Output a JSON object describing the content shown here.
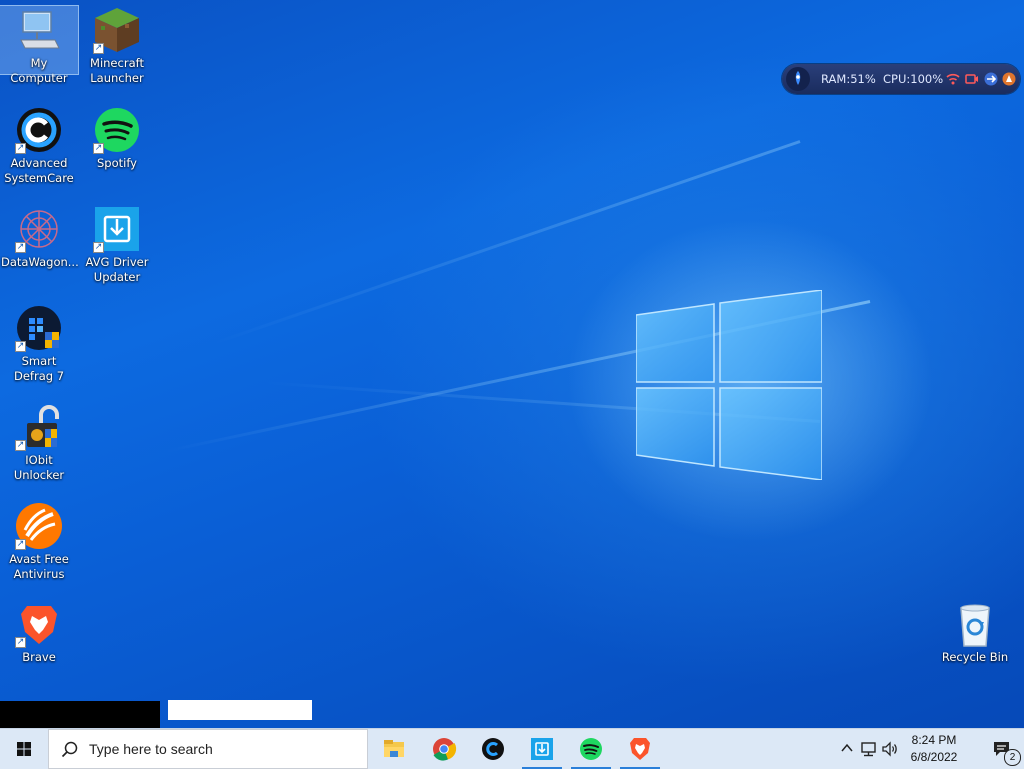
{
  "desktop": {
    "icons": [
      {
        "label": "My Computer",
        "icon": "computer-icon"
      },
      {
        "label": "Minecraft Launcher",
        "icon": "minecraft-icon"
      },
      {
        "label": "Advanced SystemCare",
        "icon": "advanced-systemcare-icon"
      },
      {
        "label": "Spotify",
        "icon": "spotify-icon"
      },
      {
        "label": "DataWagon...",
        "icon": "datawagon-icon"
      },
      {
        "label": "AVG Driver Updater",
        "icon": "avg-driver-updater-icon"
      },
      {
        "label": "Smart Defrag 7",
        "icon": "smart-defrag-icon"
      },
      {
        "label": "IObit Unlocker",
        "icon": "iobit-unlocker-icon"
      },
      {
        "label": "Avast Free Antivirus",
        "icon": "avast-icon"
      },
      {
        "label": "Brave",
        "icon": "brave-icon"
      },
      {
        "label": "Recycle Bin",
        "icon": "recycle-bin-icon"
      }
    ]
  },
  "perf_widget": {
    "ram": "RAM:51%",
    "cpu": "CPU:100%"
  },
  "taskbar": {
    "search_placeholder": "Type here to search",
    "apps": [
      {
        "name": "file-explorer",
        "icon": "folder-icon"
      },
      {
        "name": "chrome",
        "icon": "chrome-icon"
      },
      {
        "name": "advanced-systemcare",
        "icon": "advanced-systemcare-icon"
      },
      {
        "name": "avg-driver-updater",
        "icon": "avg-driver-updater-icon"
      },
      {
        "name": "spotify",
        "icon": "spotify-icon"
      },
      {
        "name": "brave",
        "icon": "brave-icon"
      }
    ],
    "clock": {
      "time": "8:24 PM",
      "date": "6/8/2022"
    },
    "notifications_count": "2"
  },
  "colors": {
    "desktop_blue": "#0a5fd6",
    "taskbar": "#dce8f6",
    "active_indicator": "#2a7fd9"
  }
}
